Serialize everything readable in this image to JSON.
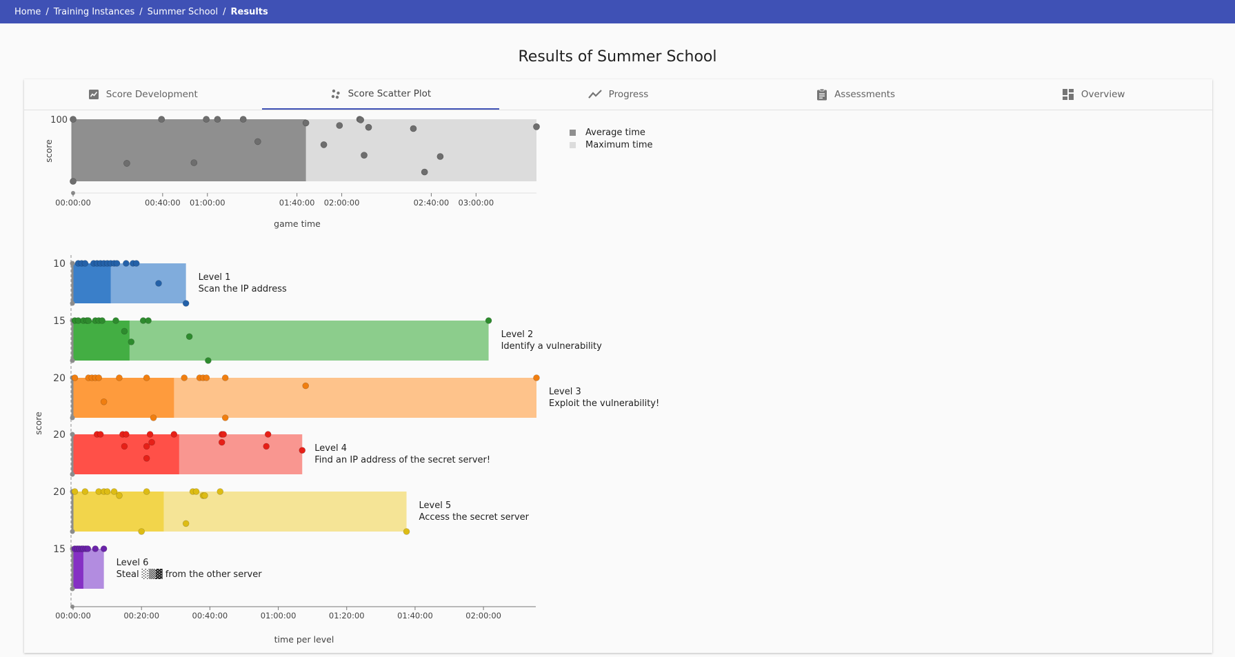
{
  "breadcrumb": {
    "items": [
      "Home",
      "Training Instances",
      "Summer School"
    ],
    "current": "Results"
  },
  "page_title": "Results of Summer School",
  "tabs": [
    {
      "label": "Score Development",
      "icon": "chart-box-icon"
    },
    {
      "label": "Score Scatter Plot",
      "icon": "scatter-dots-icon",
      "active": true
    },
    {
      "label": "Progress",
      "icon": "trend-line-icon"
    },
    {
      "label": "Assessments",
      "icon": "clipboard-icon"
    },
    {
      "label": "Overview",
      "icon": "dashboard-icon"
    }
  ],
  "legend": {
    "average_label": "Average time",
    "maximum_label": "Maximum time",
    "average_color": "#8f8f8f",
    "maximum_color": "#dcdcdc"
  },
  "chart_data": [
    {
      "type": "scatter",
      "name": "game-time-chart",
      "xlabel": "game time",
      "ylabel": "score",
      "y_tick_labels": [
        "100"
      ],
      "x_tick_labels": [
        "00:00:00",
        "00:40:00",
        "01:00:00",
        "01:40:00",
        "02:00:00",
        "02:40:00",
        "03:00:00"
      ],
      "x_ticks_minutes": [
        0,
        40,
        60,
        100,
        120,
        160,
        180
      ],
      "xlim_minutes": [
        0,
        207
      ],
      "ylim": [
        0,
        100
      ],
      "average_time_minutes": 104,
      "maximum_time_minutes": 207,
      "points": [
        [
          0,
          100
        ],
        [
          39.5,
          100
        ],
        [
          59.5,
          100
        ],
        [
          64.5,
          100
        ],
        [
          76,
          100
        ],
        [
          104,
          94
        ],
        [
          119,
          90
        ],
        [
          128,
          100
        ],
        [
          128.5,
          99
        ],
        [
          132,
          87
        ],
        [
          152,
          85
        ],
        [
          207,
          88
        ],
        [
          82.5,
          64
        ],
        [
          112,
          59
        ],
        [
          130,
          42
        ],
        [
          24,
          29
        ],
        [
          54,
          30
        ],
        [
          157,
          15
        ],
        [
          164,
          40
        ],
        [
          0,
          0
        ]
      ],
      "point_color": "#6e6e6e"
    },
    {
      "type": "scatter",
      "name": "time-per-level-chart",
      "xlabel": "time per level",
      "ylabel": "score",
      "x_tick_labels": [
        "00:00:00",
        "00:20:00",
        "00:40:00",
        "01:00:00",
        "01:20:00",
        "01:40:00",
        "02:00:00"
      ],
      "x_ticks_minutes": [
        0,
        20,
        40,
        60,
        80,
        100,
        120
      ],
      "xlim_minutes": [
        0,
        135.5
      ],
      "levels": [
        {
          "title": "Level 1",
          "subtitle": "Scan the IP address",
          "max_score": "10",
          "average_minutes": 11,
          "maximum_minutes": 33,
          "dark_color": "#3a7fc9",
          "light_color": "#80acdc",
          "point_color": "#2461a8",
          "points": [
            [
              1.5,
              10
            ],
            [
              2.5,
              10
            ],
            [
              3.5,
              10
            ],
            [
              6,
              10
            ],
            [
              7,
              10
            ],
            [
              8,
              10
            ],
            [
              9,
              10
            ],
            [
              10,
              10
            ],
            [
              11,
              10
            ],
            [
              12,
              10
            ],
            [
              12.8,
              10
            ],
            [
              15.5,
              10
            ],
            [
              17.5,
              10
            ],
            [
              18.5,
              10
            ],
            [
              25,
              5
            ],
            [
              33,
              0
            ]
          ]
        },
        {
          "title": "Level 2",
          "subtitle": " Identify a vulnerability",
          "max_score": "15",
          "average_minutes": 16.5,
          "maximum_minutes": 121.5,
          "dark_color": "#43ae43",
          "light_color": "#8ccd8c",
          "point_color": "#2e8b2e",
          "points": [
            [
              0.5,
              15
            ],
            [
              1.5,
              15
            ],
            [
              3,
              15
            ],
            [
              4,
              15
            ],
            [
              4.5,
              15
            ],
            [
              6.5,
              15
            ],
            [
              7.5,
              15
            ],
            [
              8.5,
              15
            ],
            [
              12.5,
              15
            ],
            [
              20.5,
              15
            ],
            [
              22,
              15
            ],
            [
              121.5,
              15
            ],
            [
              15,
              11
            ],
            [
              17,
              7
            ],
            [
              34,
              9
            ],
            [
              39.5,
              0
            ]
          ]
        },
        {
          "title": "Level 3",
          "subtitle": "Exploit the vulnerability!",
          "max_score": "20",
          "average_minutes": 29.5,
          "maximum_minutes": 135.5,
          "dark_color": "#fe9b3d",
          "light_color": "#fec38b",
          "point_color": "#f07e10",
          "points": [
            [
              0.5,
              20
            ],
            [
              4.5,
              20
            ],
            [
              5.5,
              20
            ],
            [
              6.5,
              20
            ],
            [
              7.5,
              20
            ],
            [
              13.5,
              20
            ],
            [
              21.5,
              20
            ],
            [
              32.5,
              20
            ],
            [
              37,
              20
            ],
            [
              38,
              20
            ],
            [
              39,
              20
            ],
            [
              44.5,
              20
            ],
            [
              68,
              16
            ],
            [
              135.5,
              20
            ],
            [
              9,
              8
            ],
            [
              23.5,
              0
            ],
            [
              44.5,
              0
            ]
          ]
        },
        {
          "title": "Level 4",
          "subtitle": "Find an IP address of the secret server!",
          "max_score": "20",
          "average_minutes": 31,
          "maximum_minutes": 67,
          "dark_color": "#ff5048",
          "light_color": "#f99690",
          "point_color": "#e62018",
          "points": [
            [
              7,
              20
            ],
            [
              8,
              20
            ],
            [
              14.5,
              20
            ],
            [
              15.5,
              20
            ],
            [
              22.5,
              20
            ],
            [
              29.5,
              20
            ],
            [
              43.5,
              20
            ],
            [
              44,
              20
            ],
            [
              57,
              20
            ],
            [
              23,
              16
            ],
            [
              43.5,
              16
            ],
            [
              15,
              14
            ],
            [
              21.5,
              14
            ],
            [
              56.5,
              14
            ],
            [
              67,
              12
            ],
            [
              21.5,
              8
            ]
          ]
        },
        {
          "title": "Level 5",
          "subtitle": "Access the secret server",
          "max_score": "20",
          "average_minutes": 26.5,
          "maximum_minutes": 97.5,
          "dark_color": "#f2d54b",
          "light_color": "#f5e496",
          "point_color": "#ddbc15",
          "points": [
            [
              0.5,
              20
            ],
            [
              3.5,
              20
            ],
            [
              7.5,
              20
            ],
            [
              9,
              20
            ],
            [
              10,
              20
            ],
            [
              12,
              20
            ],
            [
              21.5,
              20
            ],
            [
              35,
              20
            ],
            [
              36,
              20
            ],
            [
              43,
              20
            ],
            [
              13.5,
              18
            ],
            [
              38,
              18
            ],
            [
              38.5,
              18
            ],
            [
              33,
              4
            ],
            [
              20,
              0
            ],
            [
              97.5,
              0
            ]
          ]
        },
        {
          "title": "Level 6",
          "subtitle": "Steal ░▒▓ from the other server",
          "max_score": "15",
          "average_minutes": 3,
          "maximum_minutes": 9,
          "dark_color": "#8530c4",
          "light_color": "#b28ce0",
          "point_color": "#6a23a8",
          "points": [
            [
              0.5,
              15
            ],
            [
              1.2,
              15
            ],
            [
              1.8,
              15
            ],
            [
              2.5,
              15
            ],
            [
              3,
              15
            ],
            [
              3.7,
              15
            ],
            [
              4.3,
              15
            ],
            [
              6.5,
              15
            ],
            [
              9,
              15
            ]
          ]
        }
      ]
    }
  ]
}
